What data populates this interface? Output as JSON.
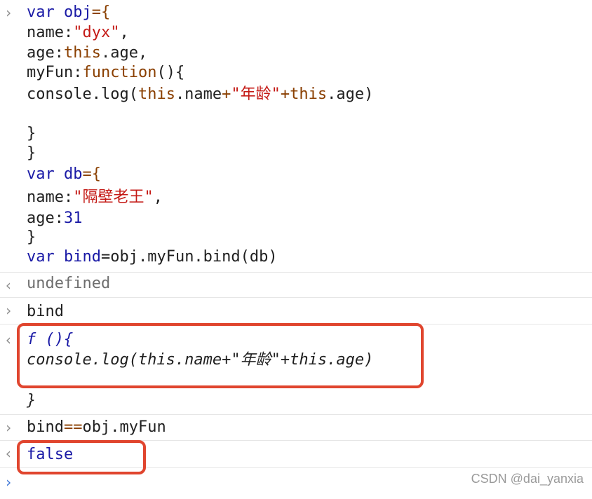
{
  "input1": {
    "prompt": "›",
    "lines": [
      {
        "p1": "var",
        "p2": " obj",
        "p3": "={"
      },
      {
        "p1": "name:",
        "p2": "\"dyx\"",
        "p3": ","
      },
      {
        "p1": "age:",
        "p2": "this",
        "p3": ".age,"
      },
      {
        "p1": "myFun:",
        "p2": "function",
        "p3": "(){"
      },
      {
        "p1": "console.log(",
        "p2": "this",
        "p3": ".name",
        "p4": "+",
        "p5": "\"年龄\"",
        "p6": "+",
        "p7": "this",
        "p8": ".age)"
      },
      {
        "p1": "}"
      },
      {
        "p1": "}"
      },
      {
        "p1": "var",
        "p2": " db",
        "p3": "={"
      },
      {
        "p1": "name:",
        "p2": "\"隔壁老王\"",
        "p3": ","
      },
      {
        "p1": "age:",
        "p2": "31"
      },
      {
        "p1": "}"
      },
      {
        "p1": "var",
        "p2": " bind",
        "p3": "=obj.myFun.bind(db)"
      }
    ]
  },
  "output1": {
    "prompt": "‹",
    "text": "undefined"
  },
  "input2": {
    "prompt": "›",
    "text": "bind"
  },
  "output2": {
    "prompt": "‹",
    "line1": "f (){",
    "line2a": "console.log(this.name+",
    "line2b": "\"年龄\"",
    "line2c": "+this.age)",
    "line3": "}"
  },
  "input3": {
    "prompt": "›",
    "p1": "bind",
    "p2": "==",
    "p3": "obj.myFun"
  },
  "output3": {
    "prompt": "‹",
    "text": "false"
  },
  "input4": {
    "prompt": "›"
  },
  "watermark": "CSDN @dai_yanxia",
  "colors": {
    "keyword": "#1a1aa6",
    "string": "#c41a16",
    "operator": "#8a3f00",
    "highlight": "#e0452e"
  }
}
